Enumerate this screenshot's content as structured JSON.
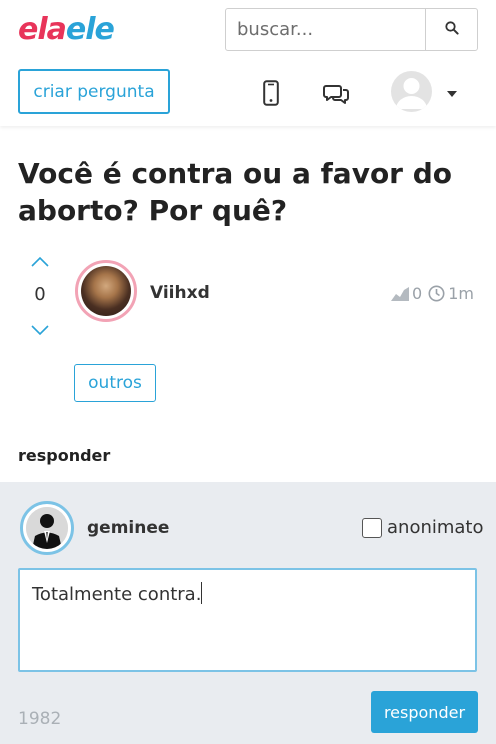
{
  "header": {
    "logo_left": "ela",
    "logo_right": "ele",
    "search_placeholder": "buscar...",
    "ask_button": "criar pergunta"
  },
  "question": {
    "title": "Você é contra ou a favor do aborto? Por quê?",
    "votes": "0",
    "author": "Viihxd",
    "level": "0",
    "time": "1m",
    "tag": "outros"
  },
  "answer_section": {
    "heading": "responder",
    "user": "geminee",
    "anon_label": "anonimato",
    "answer_text": "Totalmente contra.",
    "char_counter": "1982",
    "submit": "responder"
  },
  "colors": {
    "accent": "#2aa3d8",
    "logo_pink": "#e8345a",
    "panel_bg": "#e9ecf0"
  }
}
